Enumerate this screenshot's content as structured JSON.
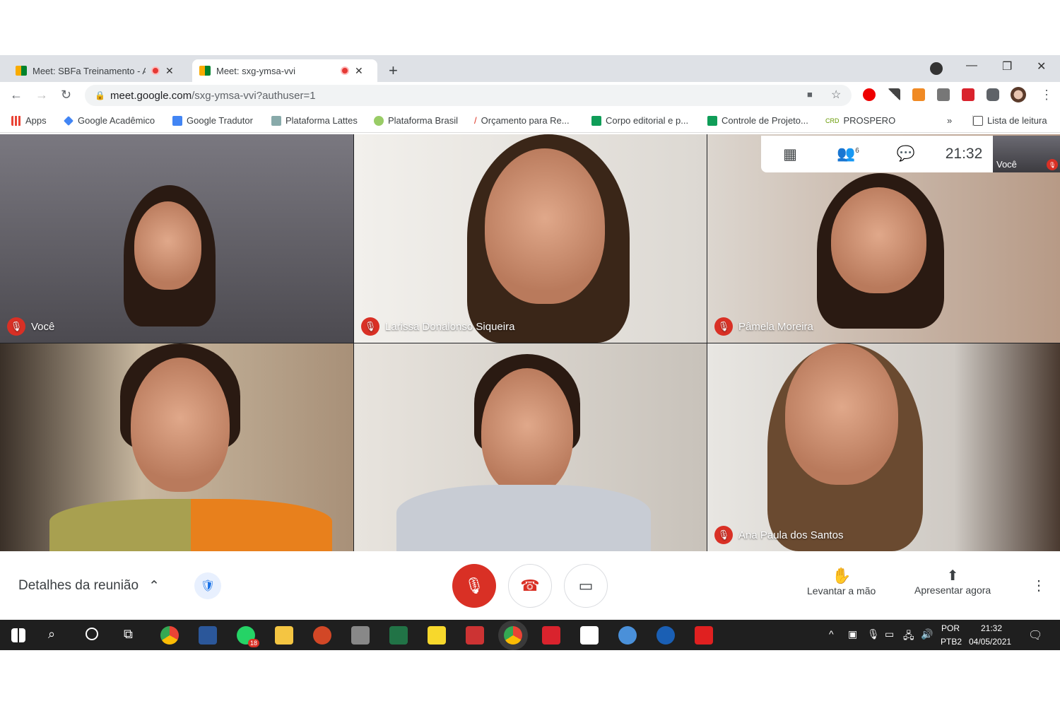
{
  "browser": {
    "tabs": [
      {
        "label": "Meet: SBFa Treinamento - Al",
        "recording": true
      },
      {
        "label": "Meet: sxg-ymsa-vvi",
        "recording": true,
        "active": true
      }
    ],
    "url_host": "meet.google.com",
    "url_path": "/sxg-ymsa-vvi?authuser=1",
    "bookmarks": [
      "Apps",
      "Google Acadêmico",
      "Google Tradutor",
      "Plataforma Lattes",
      "Plataforma Brasil",
      "Orçamento para Re...",
      "Corpo editorial e p...",
      "Controle de Projeto...",
      "PROSPERO"
    ],
    "reading_list": "Lista de leitura",
    "overflow": "»"
  },
  "meet": {
    "clock": "21:32",
    "self_label": "Você",
    "participant_badge": "6",
    "participants": [
      {
        "name": "Você",
        "muted": true
      },
      {
        "name": "Larissa Donalonso Siqueira",
        "muted": true
      },
      {
        "name": "Pâmela Moreira",
        "muted": true
      },
      {
        "name": "",
        "muted": false
      },
      {
        "name": "",
        "muted": false
      },
      {
        "name": "Ana Paula dos Santos",
        "muted": true
      }
    ],
    "details_label": "Detalhes da reunião",
    "raise_hand": "Levantar a mão",
    "present_now": "Apresentar agora",
    "colors": {
      "mute_red": "#d93025",
      "accent_blue": "#1a73e8"
    }
  },
  "taskbar": {
    "lang_top": "POR",
    "lang_bottom": "PTB2",
    "time": "21:32",
    "date": "04/05/2021",
    "whatsapp_badge": "18"
  }
}
